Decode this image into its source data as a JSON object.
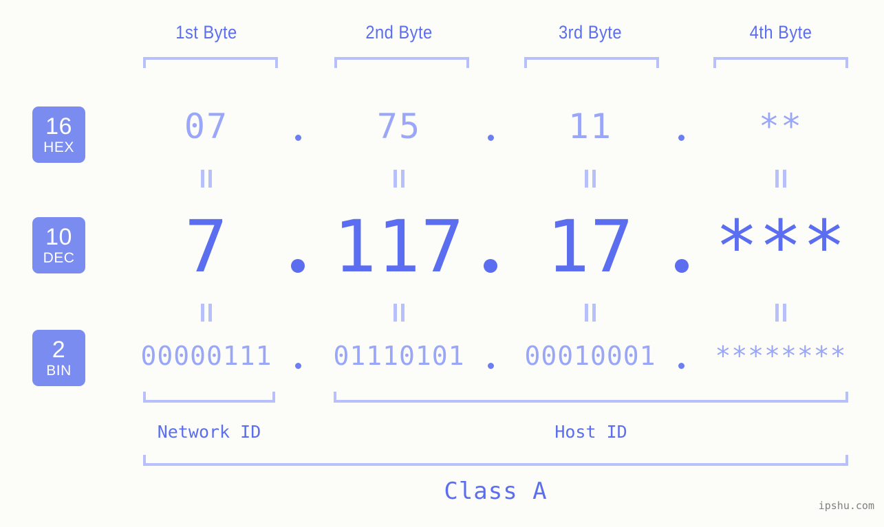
{
  "page": {
    "watermark": "ipshu.com",
    "background_color": "#fcfdf8",
    "accent_color": "#5b6ef0",
    "muted_color": "#9aa6f7",
    "bracket_color": "#b7c0fa",
    "badge_color": "#7b8cf0"
  },
  "byte_headers": [
    {
      "label": "1st Byte"
    },
    {
      "label": "2nd Byte"
    },
    {
      "label": "3rd Byte"
    },
    {
      "label": "4th Byte"
    }
  ],
  "bases": [
    {
      "num": "16",
      "name": "HEX"
    },
    {
      "num": "10",
      "name": "DEC"
    },
    {
      "num": "2",
      "name": "BIN"
    }
  ],
  "rows": {
    "hex": {
      "values": [
        "07",
        "75",
        "11",
        "**"
      ]
    },
    "dec": {
      "values": [
        "7",
        "117",
        "17",
        "***"
      ]
    },
    "bin": {
      "values": [
        "00000111",
        "01110101",
        "00010001",
        "********"
      ]
    }
  },
  "separators": {
    "symbol": "."
  },
  "equals": {
    "symbol": "="
  },
  "id_spans": [
    {
      "label": "Network ID"
    },
    {
      "label": "Host ID"
    }
  ],
  "class": {
    "label": "Class A"
  },
  "chart_data": {
    "type": "table",
    "title": "Class A",
    "columns": [
      "1st Byte",
      "2nd Byte",
      "3rd Byte",
      "4th Byte"
    ],
    "rows": [
      {
        "base": 16,
        "base_name": "HEX",
        "values": [
          "07",
          "75",
          "11",
          "**"
        ]
      },
      {
        "base": 10,
        "base_name": "DEC",
        "values": [
          "7",
          "117",
          "17",
          "***"
        ]
      },
      {
        "base": 2,
        "base_name": "BIN",
        "values": [
          "00000111",
          "01110101",
          "00010001",
          "********"
        ]
      }
    ],
    "network_id_bytes": [
      1
    ],
    "host_id_bytes": [
      2,
      3,
      4
    ],
    "address": "7.117.17.***"
  }
}
